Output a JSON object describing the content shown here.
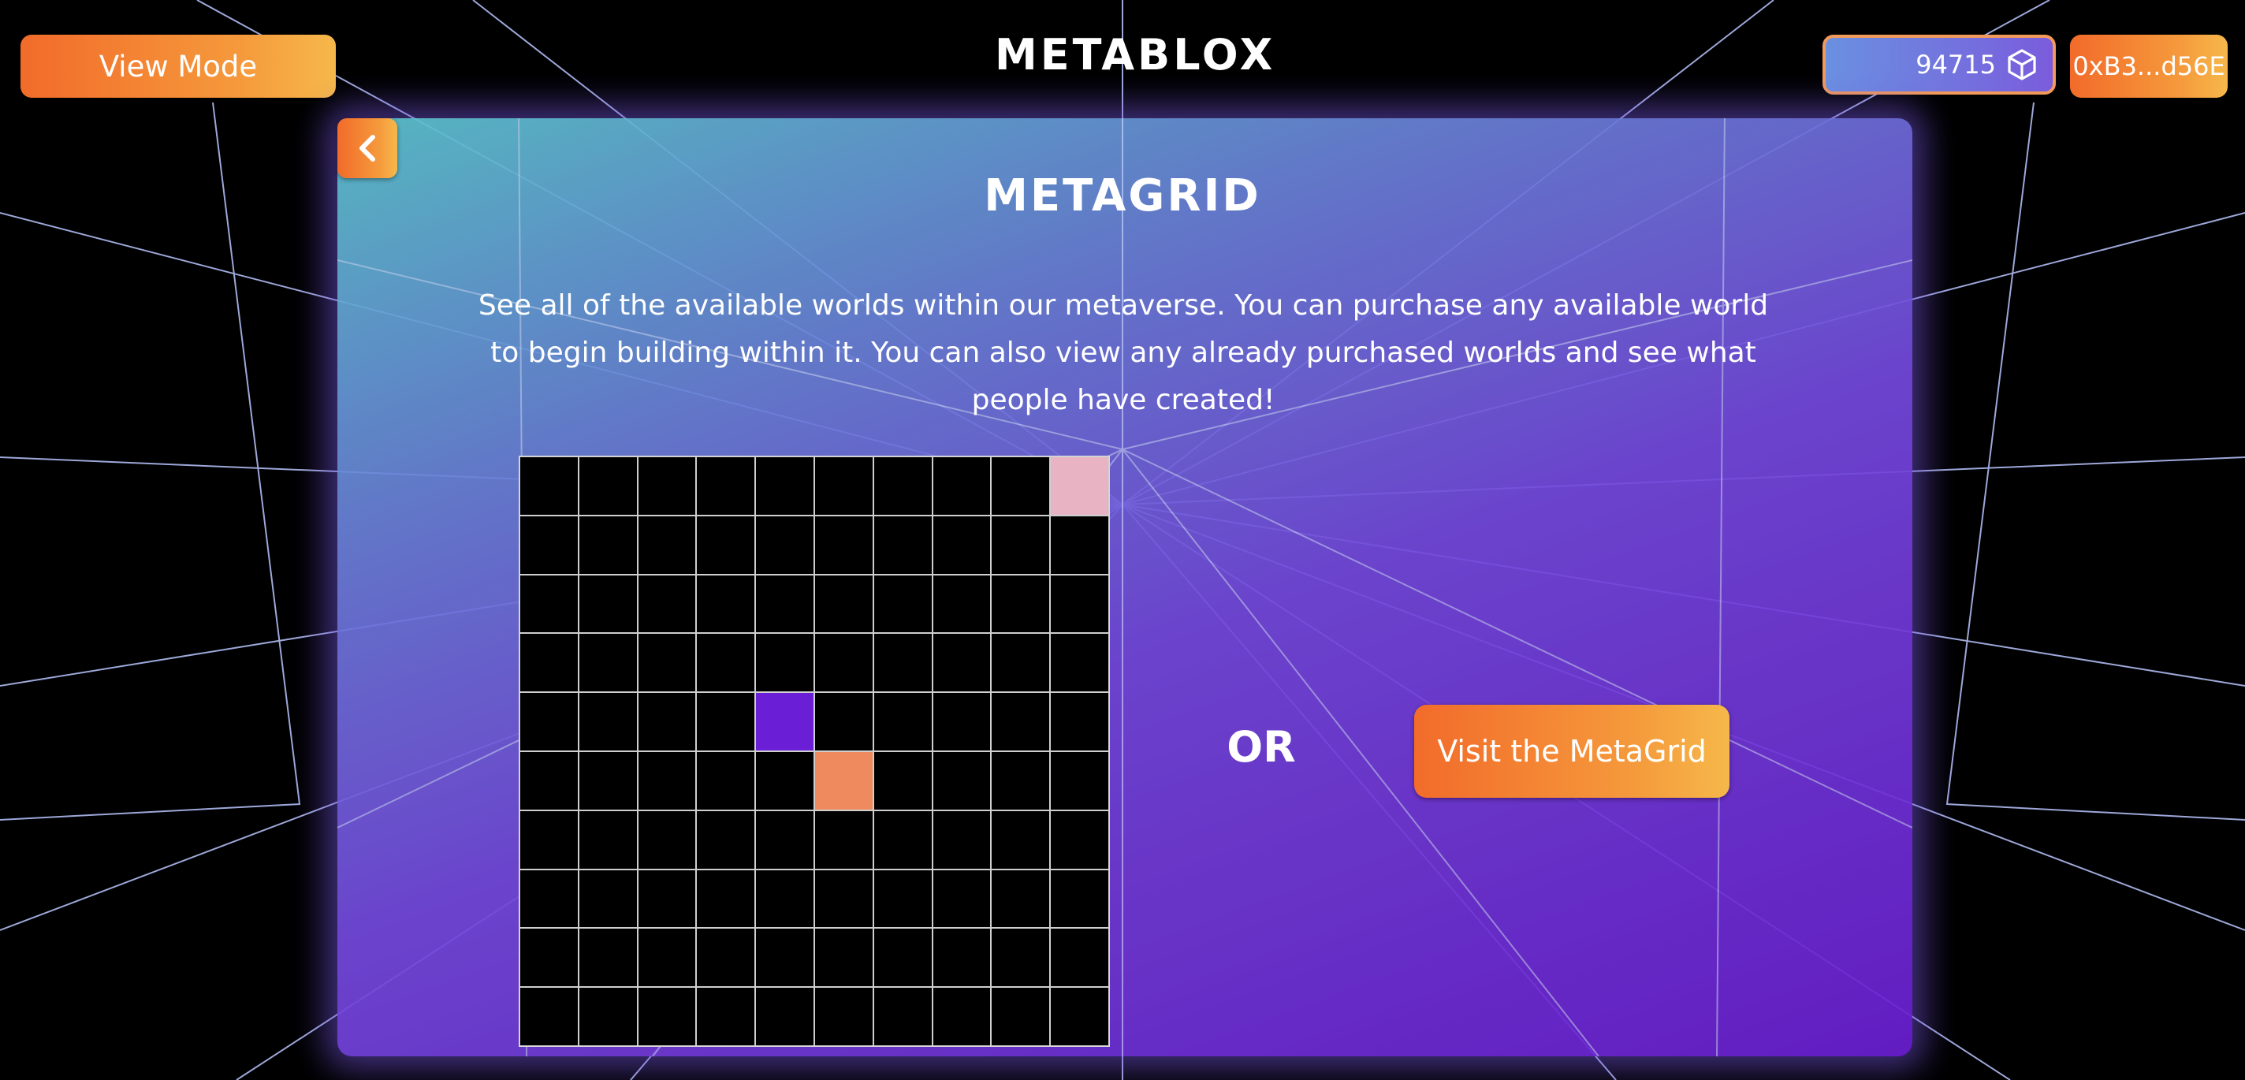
{
  "header": {
    "view_mode_label": "View Mode",
    "logo_text": "METABLOX",
    "balance_value": "94715",
    "balance_icon": "cube-token-icon",
    "wallet_address": "0xB3...d56E"
  },
  "panel": {
    "back_icon": "chevron-left-icon",
    "title": "METAGRID",
    "description": "See all of the available worlds within our metaverse. You can purchase any available world to begin building within it. You can also view any already purchased worlds and see what people have created!",
    "or_label": "OR",
    "visit_button_label": "Visit the MetaGrid"
  },
  "metagrid": {
    "rows": 10,
    "cols": 10,
    "highlighted_cells": [
      {
        "row": 0,
        "col": 9,
        "color": "#e8b4c4"
      },
      {
        "row": 4,
        "col": 4,
        "color": "#6a1fd6"
      },
      {
        "row": 5,
        "col": 5,
        "color": "#ee8a5e"
      }
    ]
  },
  "colors": {
    "accent_orange": "#f26b2a",
    "panel_teal": "#5cc4cf",
    "panel_purple": "#6a1fd0"
  }
}
